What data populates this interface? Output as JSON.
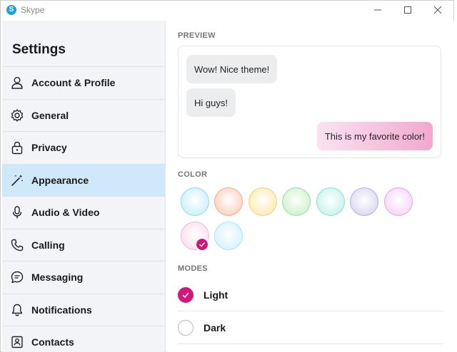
{
  "window": {
    "app_name": "Skype",
    "logo_letter": "S"
  },
  "sidebar": {
    "title": "Settings",
    "items": [
      {
        "label": "Account & Profile",
        "icon": "person-icon"
      },
      {
        "label": "General",
        "icon": "gear-icon"
      },
      {
        "label": "Privacy",
        "icon": "lock-icon"
      },
      {
        "label": "Appearance",
        "icon": "magic-wand-icon",
        "active": true
      },
      {
        "label": "Audio & Video",
        "icon": "microphone-icon"
      },
      {
        "label": "Calling",
        "icon": "phone-icon"
      },
      {
        "label": "Messaging",
        "icon": "chat-icon"
      },
      {
        "label": "Notifications",
        "icon": "bell-icon"
      },
      {
        "label": "Contacts",
        "icon": "contact-card-icon"
      }
    ]
  },
  "preview": {
    "heading": "PREVIEW",
    "messages": [
      {
        "text": "Wow! Nice theme!",
        "mine": false
      },
      {
        "text": "Hi guys!",
        "mine": false
      },
      {
        "text": "This is my favorite color!",
        "mine": true
      }
    ]
  },
  "color": {
    "heading": "COLOR",
    "swatches": [
      {
        "fill": "#cdf1fb",
        "ring": "#8fdcf3"
      },
      {
        "fill": "#fbd3c2",
        "ring": "#f1ad91"
      },
      {
        "fill": "#fdecb4",
        "ring": "#f4d27a"
      },
      {
        "fill": "#cff3cf",
        "ring": "#9ee09e"
      },
      {
        "fill": "#c9f4ea",
        "ring": "#86e3cd"
      },
      {
        "fill": "#dcdaf2",
        "ring": "#b4b0e3"
      },
      {
        "fill": "#f6d7f7",
        "ring": "#e3a7e6"
      },
      {
        "fill": "#fbe0ee",
        "ring": "#f1b8d6",
        "selected": true
      },
      {
        "fill": "#d5f4fb",
        "ring": "#a9e6f4"
      }
    ],
    "accent": "#d1177b"
  },
  "modes": {
    "heading": "MODES",
    "options": [
      {
        "label": "Light",
        "selected": true
      },
      {
        "label": "Dark",
        "selected": false
      }
    ]
  }
}
